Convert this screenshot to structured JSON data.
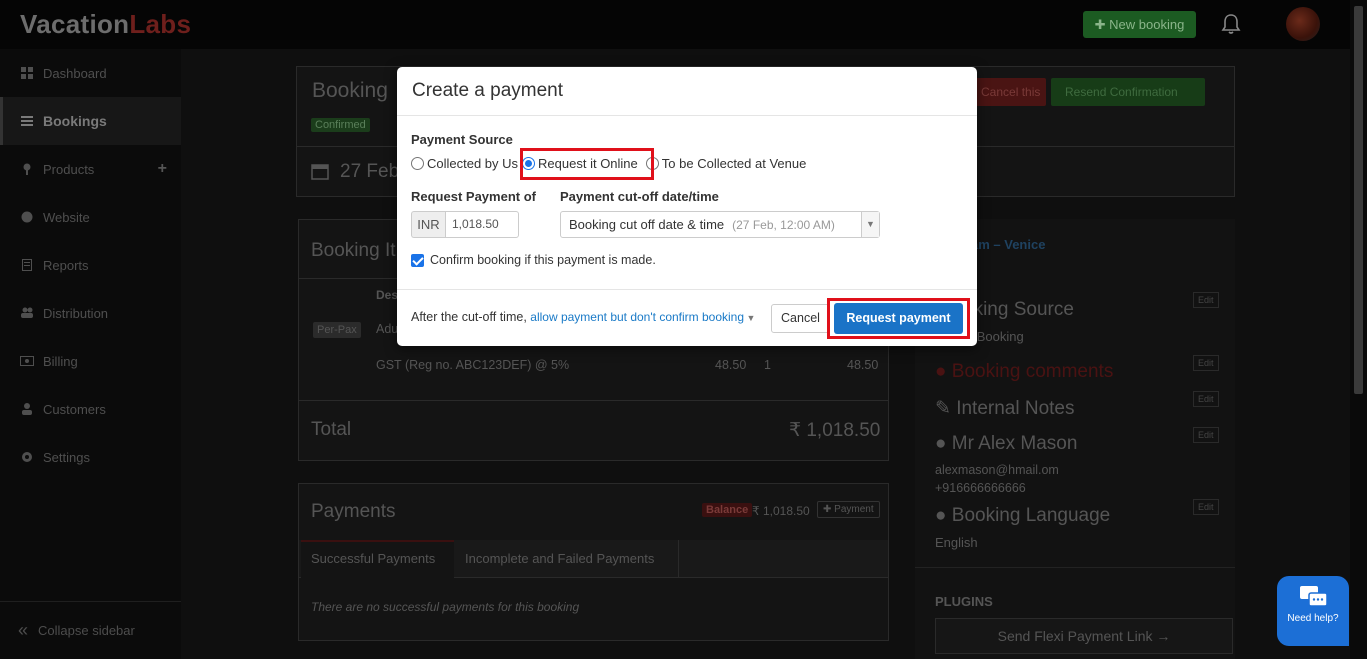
{
  "topbar": {
    "logo_part1": "Vacation",
    "logo_part2": "Labs",
    "new_booking": "✚ New booking",
    "colors": {
      "accent_green": "#1c5b22",
      "brand_red": "#6e1f1c"
    }
  },
  "sidebar": {
    "items": [
      {
        "label": "Dashboard",
        "icon": "dashboard-icon"
      },
      {
        "label": "Bookings",
        "icon": "list-icon"
      },
      {
        "label": "Products",
        "icon": "map-pin-icon"
      },
      {
        "label": "Website",
        "icon": "globe-icon"
      },
      {
        "label": "Reports",
        "icon": "report-icon"
      },
      {
        "label": "Distribution",
        "icon": "users-icon"
      },
      {
        "label": "Billing",
        "icon": "money-icon"
      },
      {
        "label": "Customers",
        "icon": "user-icon"
      },
      {
        "label": "Settings",
        "icon": "gear-icon"
      }
    ],
    "collapse": "Collapse sidebar"
  },
  "background": {
    "booking_title": "Booking",
    "status_badge": "Confirmed",
    "date": "27 Feb",
    "cancel_btn": "Cancel this",
    "resend_btn": "Resend Confirmation",
    "booking_items_title": "Booking It",
    "col_desc": "Des",
    "per_pax": "Per-Pax",
    "row_desc": "Adu",
    "gst_label": "GST (Reg no. ABC123DEF) @ 5%",
    "gst_rate": "48.50",
    "gst_qty": "1",
    "gst_total": "48.50",
    "total_label": "Total",
    "total_value": "₹ 1,018.50",
    "payments_title": "Payments",
    "balance_badge": "Balance",
    "balance_value": "₹ 1,018.50",
    "payment_btn": "✚ Payment",
    "tab_success": "Successful Payments",
    "tab_failed": "Incomplete and Failed Payments",
    "no_payments": "There are no successful payments for this booking",
    "product_link": "rdam – Venice",
    "booking_source_title": "oking Source",
    "booking_source_value": "ct Booking",
    "comments_title": "Booking comments",
    "notes_title": "Internal Notes",
    "customer_name": "Mr Alex Mason",
    "customer_email": "alexmason@hmail.om",
    "customer_phone": "+916666666666",
    "language_title": "Booking Language",
    "language_value": "English",
    "plugins_label": "PLUGINS",
    "flexi_link": "Send Flexi Payment Link →",
    "edit": "Edit"
  },
  "modal": {
    "title": "Create a payment",
    "payment_source_label": "Payment Source",
    "radio_options": [
      "Collected by Us",
      "Request it Online",
      "To be Collected at Venue"
    ],
    "selected_radio": "Request it Online",
    "request_payment_of_label": "Request Payment of",
    "currency": "INR",
    "amount": "1,018.50",
    "cutoff_label": "Payment cut-off date/time",
    "cutoff_value": "Booking cut off date & time",
    "cutoff_hint": "(27 Feb, 12:00 AM)",
    "confirm_checkbox_label": "Confirm booking if this payment is made.",
    "confirm_checked": true,
    "after_cutoff_text": "After the cut-off time,",
    "after_cutoff_option": "allow payment but don't confirm booking",
    "cancel_label": "Cancel",
    "request_label": "Request payment",
    "colors": {
      "primary": "#1a73c7",
      "highlight": "#e0101a"
    }
  },
  "help_widget": {
    "label": "Need help?"
  }
}
